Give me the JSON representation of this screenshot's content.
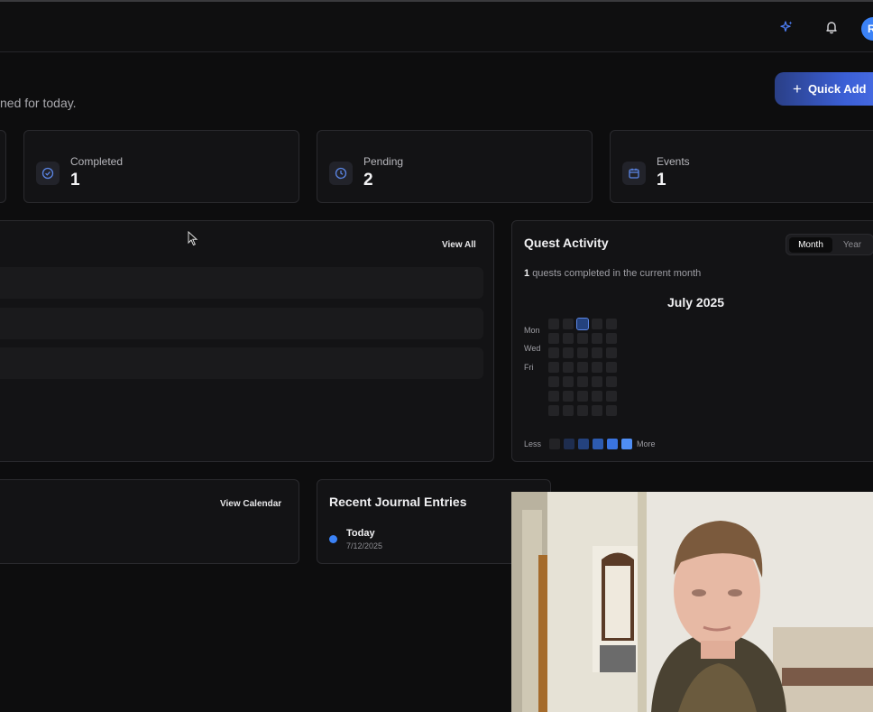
{
  "header": {
    "icons": [
      "sparkles-icon",
      "bell-icon"
    ],
    "avatar_initial": "R",
    "subtitle": "ned for today."
  },
  "quick_add_label": "Quick Add",
  "stats": [
    {
      "label": "Completed",
      "value": "1",
      "icon": "check-circle-icon"
    },
    {
      "label": "Pending",
      "value": "2",
      "icon": "clock-icon"
    },
    {
      "label": "Events",
      "value": "1",
      "icon": "calendar-icon"
    }
  ],
  "quests_panel": {
    "view_all_label": "View All",
    "skeleton_rows": 3
  },
  "quest_activity": {
    "title": "Quest Activity",
    "toggle": {
      "month": "Month",
      "year": "Year",
      "selected": "Month"
    },
    "summary_count": "1",
    "summary_text": "quests completed in the current month",
    "month_label": "July 2025",
    "day_labels": [
      "Mon",
      "Wed",
      "Fri"
    ],
    "legend_less": "Less",
    "legend_more": "More",
    "legend_colors": [
      "#232326",
      "#1e2d4f",
      "#24427e",
      "#2d5bb0",
      "#3a74e0",
      "#4f8ef5"
    ],
    "empty_cell_color": "#242427",
    "highlight_color": "#24427e"
  },
  "calendar_panel": {
    "view_calendar_label": "View Calendar"
  },
  "recent_journal": {
    "title": "Recent Journal Entries",
    "entries": [
      {
        "label": "Today",
        "date": "7/12/2025"
      }
    ]
  },
  "accent_color": "#3b82f6"
}
